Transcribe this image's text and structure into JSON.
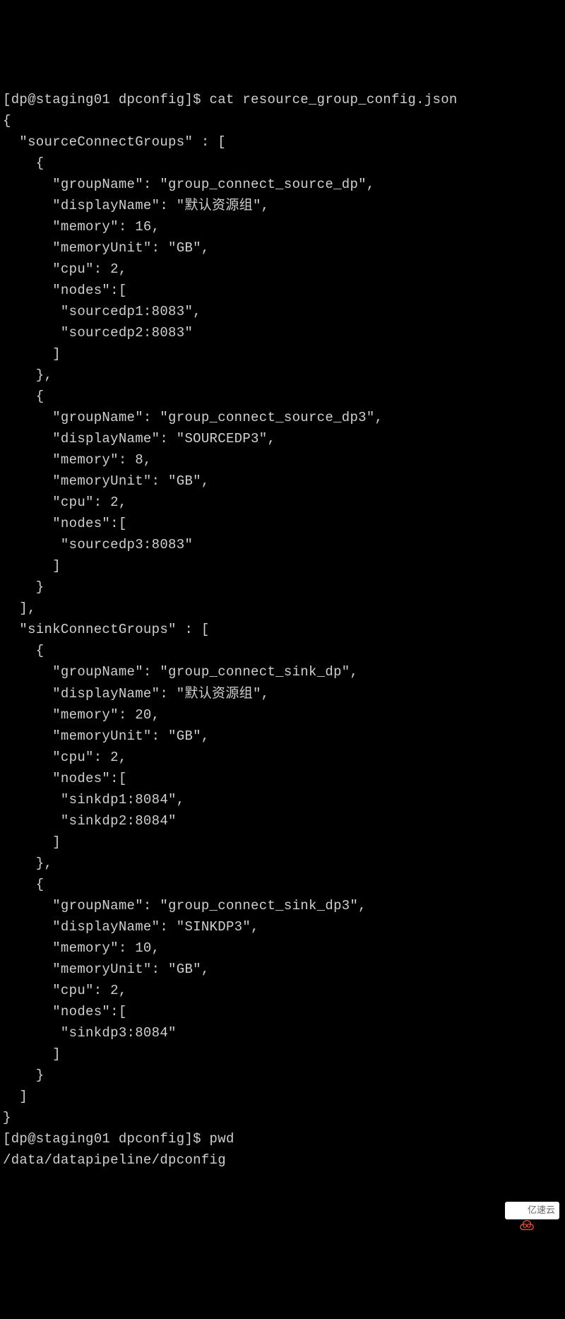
{
  "terminal": {
    "prompt1": "[dp@staging01 dpconfig]$ ",
    "command1": "cat resource_group_config.json",
    "json_output": "{\n  \"sourceConnectGroups\" : [\n    {\n      \"groupName\": \"group_connect_source_dp\",\n      \"displayName\": \"默认资源组\",\n      \"memory\": 16,\n      \"memoryUnit\": \"GB\",\n      \"cpu\": 2,\n      \"nodes\":[\n       \"sourcedp1:8083\",\n       \"sourcedp2:8083\"\n      ]\n    },\n    {\n      \"groupName\": \"group_connect_source_dp3\",\n      \"displayName\": \"SOURCEDP3\",\n      \"memory\": 8,\n      \"memoryUnit\": \"GB\",\n      \"cpu\": 2,\n      \"nodes\":[\n       \"sourcedp3:8083\"\n      ]\n    }\n  ],\n  \"sinkConnectGroups\" : [\n    {\n      \"groupName\": \"group_connect_sink_dp\",\n      \"displayName\": \"默认资源组\",\n      \"memory\": 20,\n      \"memoryUnit\": \"GB\",\n      \"cpu\": 2,\n      \"nodes\":[\n       \"sinkdp1:8084\",\n       \"sinkdp2:8084\"\n      ]\n    },\n    {\n      \"groupName\": \"group_connect_sink_dp3\",\n      \"displayName\": \"SINKDP3\",\n      \"memory\": 10,\n      \"memoryUnit\": \"GB\",\n      \"cpu\": 2,\n      \"nodes\":[\n       \"sinkdp3:8084\"\n      ]\n    }\n  ]\n}",
    "prompt2": "[dp@staging01 dpconfig]$ ",
    "command2": "pwd",
    "pwd_output": "/data/datapipeline/dpconfig",
    "prompt3": "[dp@staging01 dpconfig]$ "
  },
  "watermark": {
    "text": "亿速云"
  }
}
